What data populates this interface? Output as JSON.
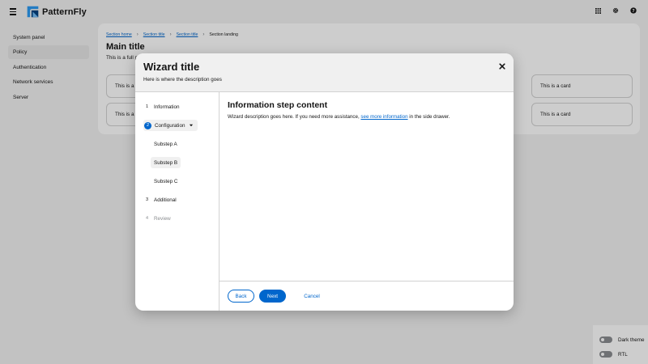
{
  "masthead": {
    "brand": "PatternFly"
  },
  "sidebar": {
    "items": [
      {
        "label": "System panel"
      },
      {
        "label": "Policy"
      },
      {
        "label": "Authentication"
      },
      {
        "label": "Network services"
      },
      {
        "label": "Server"
      }
    ]
  },
  "main": {
    "breadcrumbs": [
      "Section home",
      "Section title",
      "Section title",
      "Section landing"
    ],
    "title": "Main title",
    "description": "This is a full p",
    "cards": [
      "This is a c",
      "This is a card",
      "This is a c",
      "This is a card"
    ]
  },
  "switcher": {
    "dark_theme": "Dark theme",
    "rtl": "RTL"
  },
  "wizard": {
    "title": "Wizard title",
    "description": "Here is where the description goes",
    "steps": [
      {
        "num": "1",
        "label": "Information"
      },
      {
        "num": "2",
        "label": "Configuration"
      },
      {
        "num": "3",
        "label": "Additional"
      },
      {
        "num": "4",
        "label": "Review"
      }
    ],
    "substeps": [
      "Substep A",
      "Substep B",
      "Substep C"
    ],
    "body": {
      "title": "Information step content",
      "text_before": "Wizard description goes here. If you need more assistance, ",
      "link": "see more information",
      "text_after": " in the side drawer."
    },
    "footer": {
      "back": "Back",
      "next": "Next",
      "cancel": "Cancel"
    }
  },
  "colors": {
    "primary": "#0066cc",
    "brand_blue": "#2b9af3"
  }
}
